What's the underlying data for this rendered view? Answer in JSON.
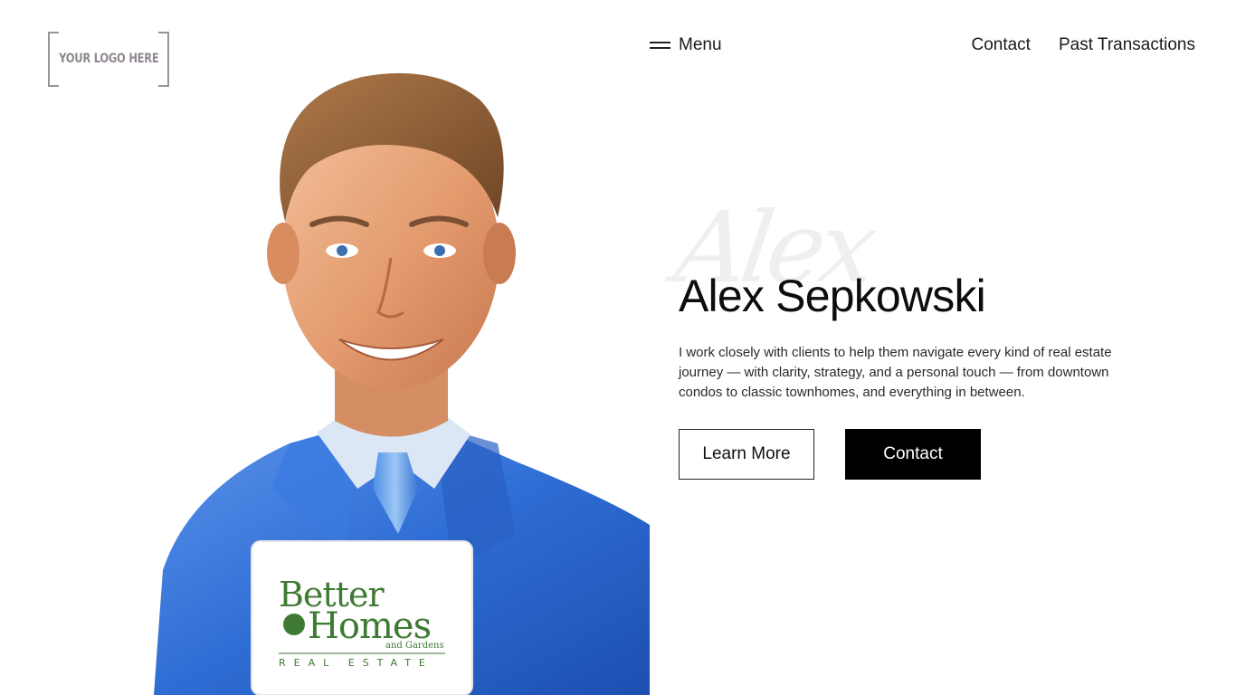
{
  "logo": {
    "text": "YOUR LOGO HERE"
  },
  "nav": {
    "menu_label": "Menu",
    "links": [
      {
        "label": "Contact"
      },
      {
        "label": "Past Transactions"
      }
    ]
  },
  "portrait": {
    "badge": {
      "line1": "Better",
      "line2": "Homes",
      "line3": "and Gardens",
      "line4": "REAL ESTATE"
    }
  },
  "hero": {
    "script_name": "Alex",
    "title": "Alex Sepkowski",
    "description": "I work closely with clients to help them navigate every kind of real estate journey — with clarity, strategy, and a personal touch — from downtown condos to classic townhomes, and everything in between.",
    "buttons": {
      "learn_more": "Learn More",
      "contact": "Contact"
    }
  },
  "colors": {
    "background": "#ffffff",
    "text": "#111111",
    "button_solid": "#000000",
    "suit": "#2f6fd4",
    "logo_gray": "#9a9399",
    "badge_green": "#3f7a34"
  }
}
